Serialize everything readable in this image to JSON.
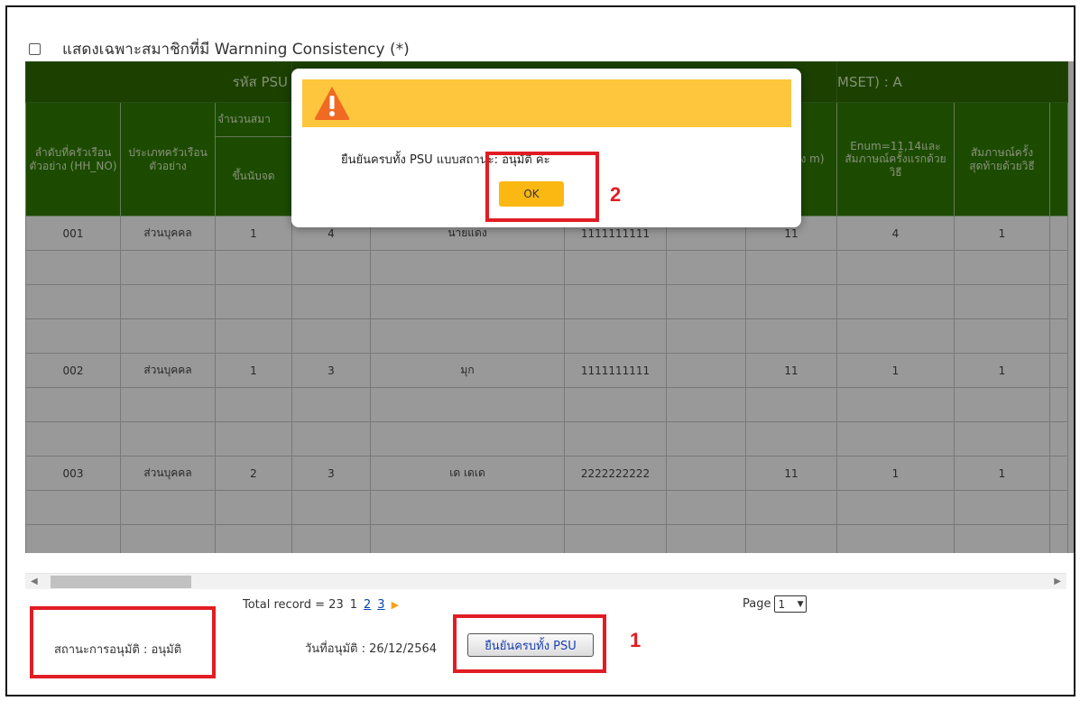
{
  "filter": {
    "label": "แสดงเฉพาะสมาชิกที่มี Warnning Consistency (*)"
  },
  "table": {
    "title_left": "รหัส PSU",
    "title_right": "MSET) : A",
    "group_header": "จำนวนสมา",
    "headers": {
      "hh_no": "ลำดับที่ครัวเรือนตัวอย่าง (HH_NO)",
      "hh_type": "ประเภทครัวเรือนตัวอย่าง",
      "count": "ขึ้นนับจด",
      "col_partial": "จงนับ อน าง m)",
      "enum": "Enum=11,14และสัมภาษณ์ครั้งแรกด้วยวิธี",
      "last_interview": "สัมภาษณ์ครั้งสุดท้ายด้วยวิธี"
    },
    "rows": [
      {
        "no": "001",
        "type": "ส่วนบุคคล",
        "a": "1",
        "b": "4",
        "name": "นายแดง",
        "id": "1111111111",
        "c": "",
        "d": "11",
        "e": "4",
        "f": "1"
      },
      {
        "no": "",
        "type": "",
        "a": "",
        "b": "",
        "name": "",
        "id": "",
        "c": "",
        "d": "",
        "e": "",
        "f": ""
      },
      {
        "no": "",
        "type": "",
        "a": "",
        "b": "",
        "name": "",
        "id": "",
        "c": "",
        "d": "",
        "e": "",
        "f": ""
      },
      {
        "no": "",
        "type": "",
        "a": "",
        "b": "",
        "name": "",
        "id": "",
        "c": "",
        "d": "",
        "e": "",
        "f": ""
      },
      {
        "no": "002",
        "type": "ส่วนบุคคล",
        "a": "1",
        "b": "3",
        "name": "มุก",
        "id": "1111111111",
        "c": "",
        "d": "11",
        "e": "1",
        "f": "1"
      },
      {
        "no": "",
        "type": "",
        "a": "",
        "b": "",
        "name": "",
        "id": "",
        "c": "",
        "d": "",
        "e": "",
        "f": ""
      },
      {
        "no": "",
        "type": "",
        "a": "",
        "b": "",
        "name": "",
        "id": "",
        "c": "",
        "d": "",
        "e": "",
        "f": ""
      },
      {
        "no": "003",
        "type": "ส่วนบุคคล",
        "a": "2",
        "b": "3",
        "name": "เด เดเด",
        "id": "2222222222",
        "c": "",
        "d": "11",
        "e": "1",
        "f": "1"
      },
      {
        "no": "",
        "type": "",
        "a": "",
        "b": "",
        "name": "",
        "id": "",
        "c": "",
        "d": "",
        "e": "",
        "f": ""
      },
      {
        "no": "",
        "type": "",
        "a": "",
        "b": "",
        "name": "",
        "id": "",
        "c": "",
        "d": "",
        "e": "",
        "f": ""
      }
    ]
  },
  "pager": {
    "total_label": "Total record = 23",
    "current": "1",
    "page2": "2",
    "page3": "3"
  },
  "page_select": {
    "label": "Page",
    "value": "1"
  },
  "status": {
    "text": "สถานะการอนุมัติ : อนุมัติ"
  },
  "approve_date": {
    "text": "วันที่อนุมัติ : 26/12/2564"
  },
  "confirm_button": {
    "label": "ยืนยันครบทั้ง PSU"
  },
  "annotations": {
    "num1": "1",
    "num2": "2",
    "color": "#e11d24"
  },
  "dialog": {
    "message": "ยืนยันครบทั้ง PSU แบบสถานะ: อนุมัติ ค่ะ",
    "ok_label": "OK",
    "header_color": "#fdc63d"
  }
}
